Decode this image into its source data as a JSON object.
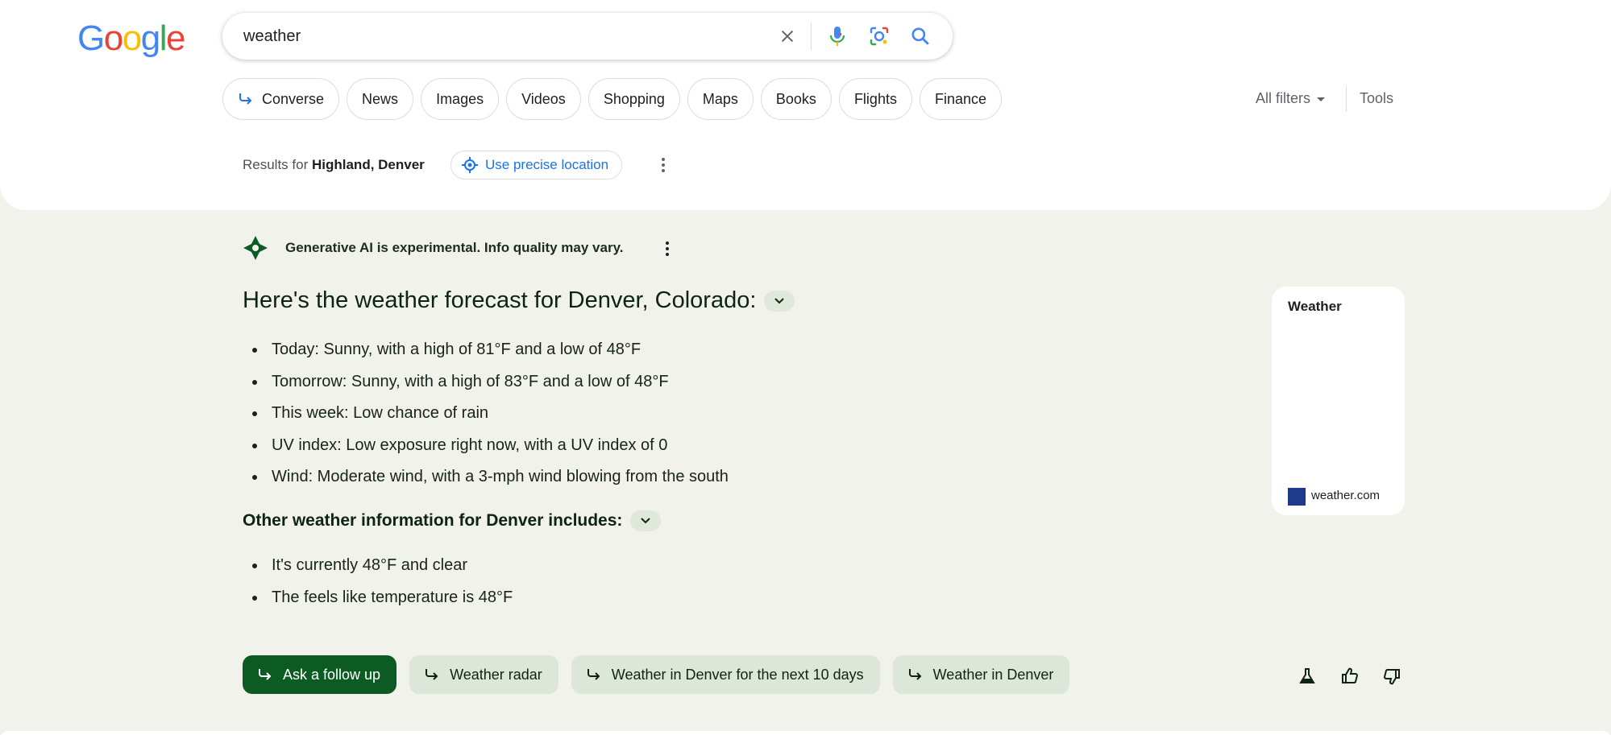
{
  "logo": {
    "letters": [
      "G",
      "o",
      "o",
      "g",
      "l",
      "e"
    ]
  },
  "search": {
    "query": "weather"
  },
  "tabs": [
    {
      "label": "Converse",
      "icon": "arrow-turn-icon"
    },
    {
      "label": "News"
    },
    {
      "label": "Images"
    },
    {
      "label": "Videos"
    },
    {
      "label": "Shopping"
    },
    {
      "label": "Maps"
    },
    {
      "label": "Books"
    },
    {
      "label": "Flights"
    },
    {
      "label": "Finance"
    }
  ],
  "filters": {
    "all_filters": "All filters",
    "tools": "Tools"
  },
  "location": {
    "prefix": "Results for",
    "place": "Highland, Denver",
    "precise_label": "Use precise location"
  },
  "ai": {
    "disclaimer": "Generative AI is experimental. Info quality may vary.",
    "heading": "Here's the weather forecast for Denver, Colorado:",
    "bullets": [
      "Today: Sunny, with a high of 81°F and a low of 48°F",
      "Tomorrow: Sunny, with a high of 83°F and a low of 48°F",
      "This week: Low chance of rain",
      "UV index: Low exposure right now, with a UV index of 0",
      "Wind: Moderate wind, with a 3-mph wind blowing from the south"
    ],
    "subheading": "Other weather information for Denver includes:",
    "bullets2": [
      "It's currently 48°F and clear",
      "The feels like temperature is 48°F"
    ],
    "followups": [
      "Ask a follow up",
      "Weather radar",
      "Weather in Denver for the next 10 days",
      "Weather in Denver"
    ]
  },
  "card": {
    "title": "Weather",
    "source": "weather.com"
  },
  "colors": {
    "accent_green": "#0b5b22",
    "chip_green": "#dde7d9",
    "link_blue": "#1a73e8"
  }
}
